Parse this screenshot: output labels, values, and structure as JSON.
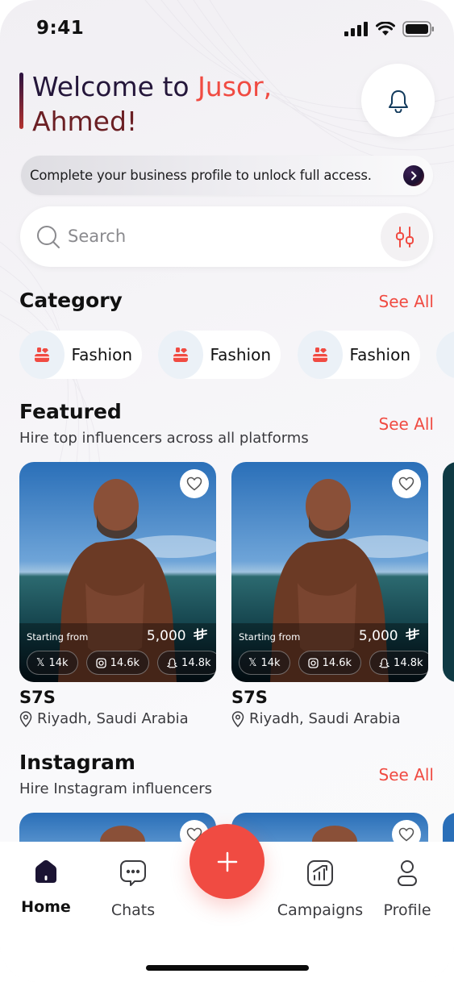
{
  "status_bar": {
    "time": "9:41"
  },
  "header": {
    "welcome_prefix": "Welcome to ",
    "brand": "Jusor,",
    "name": "Ahmed!"
  },
  "banner": {
    "text": "Complete your business profile to unlock full access."
  },
  "search": {
    "placeholder": "Search"
  },
  "category": {
    "title": "Category",
    "see_all": "See All",
    "items": [
      {
        "label": "Fashion",
        "icon": "fashion-icon"
      },
      {
        "label": "Fashion",
        "icon": "fashion-icon"
      },
      {
        "label": "Fashion",
        "icon": "fashion-icon"
      }
    ]
  },
  "featured": {
    "title": "Featured",
    "subtitle": "Hire top influencers across all platforms",
    "see_all": "See All",
    "cards": [
      {
        "starting_label": "Starting from",
        "price": "5,000",
        "currency_icon": "riyal-icon",
        "stats": {
          "x": "14k",
          "instagram": "14.6k",
          "snapchat": "14.8k"
        },
        "name": "S7S",
        "location": "Riyadh, Saudi Arabia"
      },
      {
        "starting_label": "Starting from",
        "price": "5,000",
        "currency_icon": "riyal-icon",
        "stats": {
          "x": "14k",
          "instagram": "14.6k",
          "snapchat": "14.8k"
        },
        "name": "S7S",
        "location": "Riyadh, Saudi Arabia"
      }
    ]
  },
  "instagram": {
    "title": "Instagram",
    "subtitle": "Hire Instagram influencers",
    "see_all": "See All"
  },
  "nav": {
    "home": "Home",
    "chats": "Chats",
    "campaigns": "Campaigns",
    "profile": "Profile"
  },
  "colors": {
    "accent": "#f04b42",
    "dark": "#24163a",
    "maroon": "#6b1f24",
    "nav_active": "#1b1433"
  }
}
